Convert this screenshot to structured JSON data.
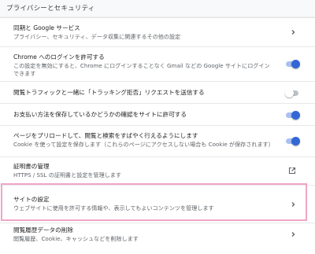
{
  "section": {
    "title": "プライバシーとセキュリティ"
  },
  "rows": [
    {
      "label": "同期と Google サービス",
      "sub": "プライバシー、セキュリティ、データ収集に関連するその他の設定",
      "control": "chevron-right-icon"
    },
    {
      "label": "Chrome へのログインを許可する",
      "sub": "この設定を無効にすると、Chrome にログインすることなく Gmail などの Google サイトにログインできます",
      "sub_line1": "この設定を無効にすると、Chrome にログインすることなく Gmail などの Google サイトにログイン",
      "sub_line2": "できます",
      "control": "toggle",
      "enabled": true
    },
    {
      "label": "閲覧トラフィックと一緒に「トラッキング拒否」リクエストを送信する",
      "control": "toggle",
      "enabled": false
    },
    {
      "label": "お支払い方法を保存しているかどうかの確認をサイトに許可する",
      "control": "toggle",
      "enabled": true
    },
    {
      "label": "ページをプリロードして、閲覧と検索をすばやく行えるようにします",
      "sub": "Cookie を使って設定を保存します（これらのページにアクセスしない場合も Cookie が保存されます）",
      "control": "toggle",
      "enabled": true
    },
    {
      "label": "証明書の管理",
      "sub": "HTTPS / SSL の証明書と設定を管理します",
      "control": "open-in-new-icon"
    },
    {
      "label": "サイトの設定",
      "sub": "ウェブサイトに使用を許可する情報や、表示してもよいコンテンツを管理します",
      "control": "chevron-right-icon",
      "highlighted": true
    },
    {
      "label": "閲覧履歴データの削除",
      "sub": "閲覧履歴、Cookie、キャッシュなどを削除します",
      "control": "chevron-right-icon"
    }
  ],
  "colors": {
    "accent": "#3367d6",
    "highlight_border": "#f0a5c8"
  }
}
